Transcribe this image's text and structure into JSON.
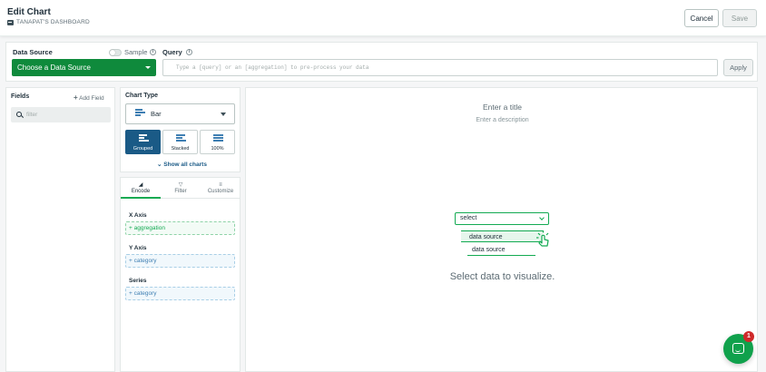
{
  "header": {
    "title": "Edit Chart",
    "breadcrumb": "TANAPAT'S DASHBOARD",
    "cancel_label": "Cancel",
    "save_label": "Save"
  },
  "query_bar": {
    "data_source_label": "Data Source",
    "sample_label": "Sample",
    "query_label": "Query",
    "data_source_select": "Choose a Data Source",
    "query_placeholder": "Type a [query] or an [aggregation] to pre-process your data",
    "apply_label": "Apply"
  },
  "fields": {
    "title": "Fields",
    "add_field_label": "Add Field",
    "filter_placeholder": "filter"
  },
  "chart_type": {
    "title": "Chart Type",
    "selected": "Bar",
    "variants": [
      "Grouped",
      "Stacked",
      "100%"
    ],
    "active_variant": "Grouped",
    "show_all_label": "Show all charts"
  },
  "encode": {
    "tabs": [
      "Encode",
      "Filter",
      "Customize"
    ],
    "active_tab": "Encode",
    "x_axis_label": "X Axis",
    "x_axis_placeholder": "+ aggregation",
    "y_axis_label": "Y Axis",
    "y_axis_placeholder": "+ category",
    "series_label": "Series",
    "series_placeholder": "+ category"
  },
  "canvas": {
    "title_placeholder": "Enter a title",
    "description_placeholder": "Enter a description",
    "illustration": {
      "select_label": "select",
      "option_1": "data source",
      "option_2": "data source"
    },
    "empty_message": "Select data to visualize."
  },
  "chat": {
    "badge_count": "1"
  },
  "colors": {
    "accent_green": "#13aa52",
    "dark_green": "#0f8a3c",
    "active_blue": "#1a5a86",
    "badge_red": "#cf2a2a"
  }
}
